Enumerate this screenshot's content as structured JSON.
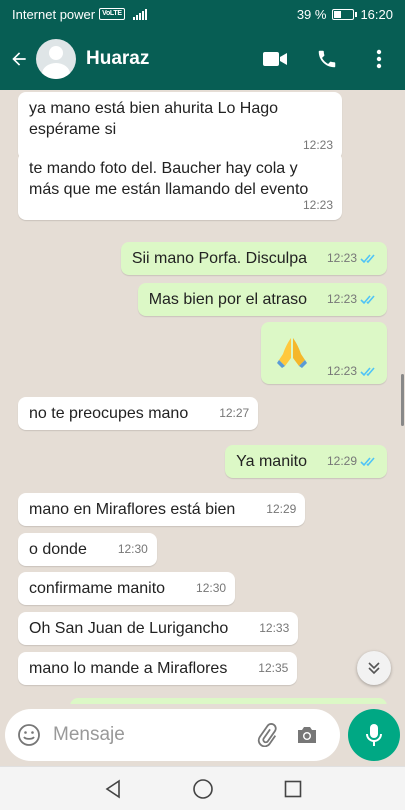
{
  "status_bar": {
    "carrier": "Internet power",
    "network_badge": "VoLTE",
    "battery_percent": "39 %",
    "battery_level": 0.39,
    "time": "16:20"
  },
  "header": {
    "contact_name": "Huaraz",
    "icons": [
      "back-arrow-icon",
      "video-call-icon",
      "phone-icon",
      "more-vert-icon"
    ]
  },
  "messages": [
    {
      "dir": "in",
      "text": "ya mano está bien ahurita Lo Hago espérame si",
      "time": "12:23"
    },
    {
      "dir": "in",
      "text": "te mando foto del. Baucher hay cola y más que me están llamando del evento",
      "time": "12:23"
    },
    {
      "dir": "out",
      "text": "Sii mano Porfa. Disculpa",
      "time": "12:23",
      "read": true
    },
    {
      "dir": "out",
      "text": "Mas bien por el atraso",
      "time": "12:23",
      "read": true
    },
    {
      "dir": "out",
      "text": "🙏",
      "time": "12:23",
      "read": true,
      "emoji": "folded-hands"
    },
    {
      "dir": "in",
      "text": "no te preocupes mano",
      "time": "12:27"
    },
    {
      "dir": "out",
      "text": "Ya manito",
      "time": "12:29",
      "read": true
    },
    {
      "dir": "in",
      "text": "mano en Miraflores está bien",
      "time": "12:29"
    },
    {
      "dir": "in",
      "text": "o donde",
      "time": "12:30"
    },
    {
      "dir": "in",
      "text": "confirmame manito",
      "time": "12:30"
    },
    {
      "dir": "in",
      "text": "Oh San Juan de Lurigancho",
      "time": "12:33"
    },
    {
      "dir": "in",
      "text": "mano lo mande a Miraflores",
      "time": "12:35"
    }
  ],
  "input": {
    "placeholder": "Mensaje",
    "value": ""
  },
  "colors": {
    "header": "#075e54",
    "chat_bg": "#e5ddd5",
    "outgoing": "#dcf8c6",
    "incoming": "#ffffff",
    "accent": "#00a884",
    "read_ticks": "#4fc3f7"
  }
}
